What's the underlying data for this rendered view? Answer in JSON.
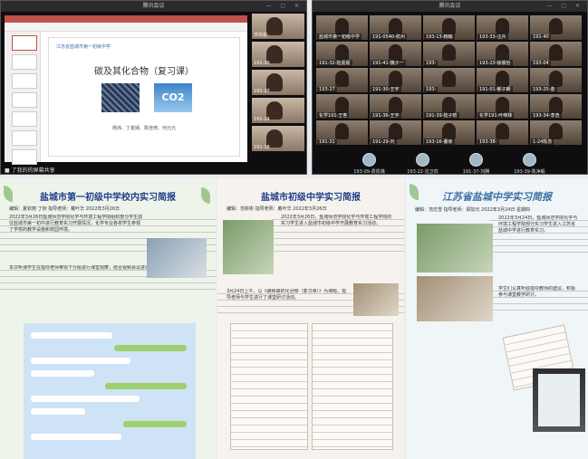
{
  "meeting_left": {
    "title": "腾讯会议",
    "share_status": "了我的的屏幕共享",
    "slide": {
      "header": "江苏省盐城市第一初级中学",
      "title": "碳及其化合物（复习课）",
      "image_text": "CO2",
      "authors": "杨炜、丁夏娴、陈佳琦、何元元"
    },
    "side_tiles": [
      {
        "label": "苏剑星"
      },
      {
        "label": "191-30"
      },
      {
        "label": "191-27"
      },
      {
        "label": "191-24"
      },
      {
        "label": "191-18"
      }
    ]
  },
  "meeting_right": {
    "title": "腾讯会议",
    "tiles": [
      {
        "label": "盐城市第一初级中学"
      },
      {
        "label": "191-0540-杭州"
      },
      {
        "label": "193-13-韩翰"
      },
      {
        "label": "193-33-汪卉"
      },
      {
        "label": "191-40"
      },
      {
        "label": "191-32-陆嘉懿"
      },
      {
        "label": "191-41-魏子一"
      },
      {
        "label": "193-"
      },
      {
        "label": "193-23-徐晨怡"
      },
      {
        "label": "193-04"
      },
      {
        "label": "193-27"
      },
      {
        "label": "191-30-王宇"
      },
      {
        "label": "193-"
      },
      {
        "label": "191-01-郁子朗"
      },
      {
        "label": "193-25-金"
      },
      {
        "label": "化学191-王茗"
      },
      {
        "label": "191-36-王宇"
      },
      {
        "label": "191-39-陆子晗"
      },
      {
        "label": "化学191-叶唯妹"
      },
      {
        "label": "193-34-李浩"
      },
      {
        "label": "191-31"
      },
      {
        "label": "191-29-刘"
      },
      {
        "label": "193-16-董家"
      },
      {
        "label": "193-38-"
      },
      {
        "label": "1-24陈苏"
      }
    ],
    "avatars": [
      {
        "label": "193-09-费凯璐"
      },
      {
        "label": "193-22-沈卫欢"
      },
      {
        "label": "191-37-刘腾"
      },
      {
        "label": "193-39-陈净毅"
      }
    ]
  },
  "panel_1": {
    "title": "盐城市第一初级中学校内实习简报",
    "meta": "编辑：夏钦丽  丁桢  指导老师：戴叶华  2022年3月26日",
    "para1": "2022年3月26日盐城师范学院化学与环境工程学院组织部分学生前往盐城市第一初中进行教育实习开展情况，化学专业各校学生参观了学校的教学设施和校园环境。",
    "para2": "本次听课学生在指导老师带领下分组进行课堂观摩，结合视频会议进行交流研讨。"
  },
  "panel_2": {
    "title": "盐城市初级中学实习简报",
    "meta": "编辑：范彬彬  指导老师：戴叶华  2022年3月26日",
    "para1": "2022年3月26日，盐城师范学院化学与环境工程学院的实习学生进入盐城市初级中学开展教育实习活动。",
    "para2": "3月24日上午，以《碳和碳的化合物（复习课）》为课题，指导老师与学生进行了课堂研讨活动。"
  },
  "panel_3": {
    "title": "江苏省盐城中学实习简报",
    "meta": "编辑：范志雪  指导老师：顾加元  2022年3月24日 星期四",
    "para1": "2022年3月24日，盐城师范学院化学与环境工程学院部分实习学生进入江苏省盐城中学进行教育实习。",
    "para2": "学生们认真听取指导教师的建议，积极参与课堂教学研讨。"
  }
}
